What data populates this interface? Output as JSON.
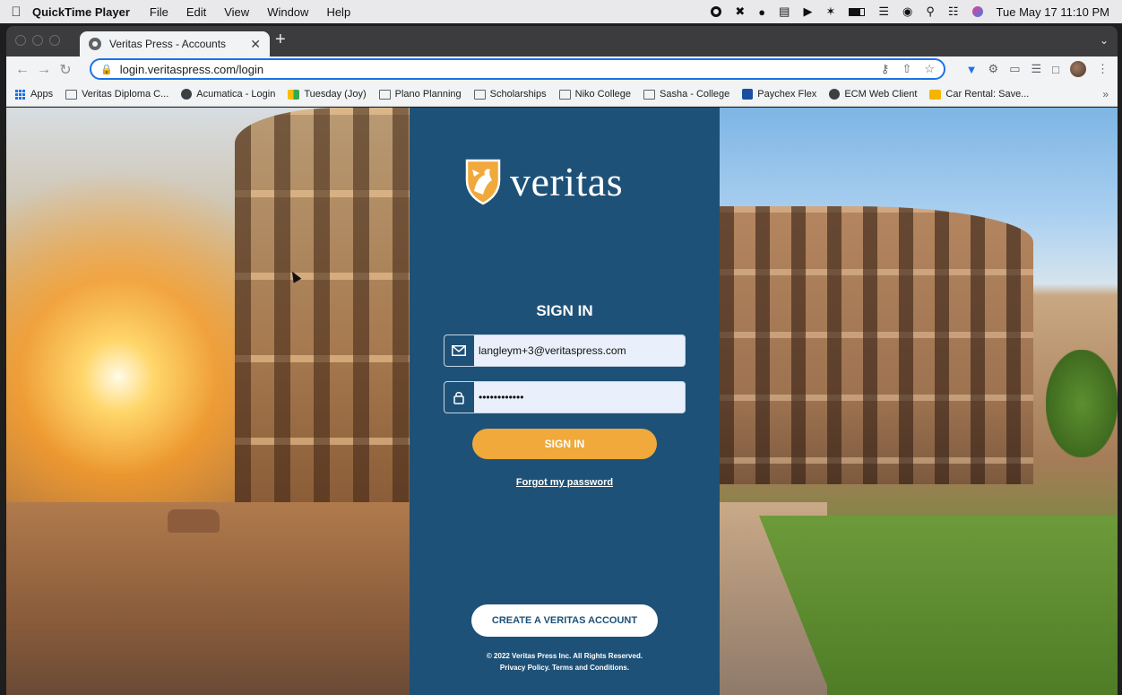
{
  "menubar": {
    "app_name": "QuickTime Player",
    "items": [
      "File",
      "Edit",
      "View",
      "Window",
      "Help"
    ],
    "datetime": "Tue May 17  11:10 PM"
  },
  "browser": {
    "tab_title": "Veritas Press - Accounts",
    "url": "login.veritaspress.com/login",
    "bookmarks": [
      {
        "label": "Apps",
        "icon": "apps-grid-icon"
      },
      {
        "label": "Veritas Diploma C...",
        "icon": "folder-icon"
      },
      {
        "label": "Acumatica - Login",
        "icon": "globe-icon"
      },
      {
        "label": "Tuesday (Joy)",
        "icon": "calendar-icon"
      },
      {
        "label": "Plano Planning",
        "icon": "folder-icon"
      },
      {
        "label": "Scholarships",
        "icon": "folder-icon"
      },
      {
        "label": "Niko College",
        "icon": "folder-icon"
      },
      {
        "label": "Sasha - College",
        "icon": "folder-icon"
      },
      {
        "label": "Paychex Flex",
        "icon": "paychex-icon"
      },
      {
        "label": "ECM Web Client",
        "icon": "globe-icon"
      },
      {
        "label": "Car Rental: Save...",
        "icon": "car-rental-icon"
      }
    ],
    "more": "»"
  },
  "login": {
    "brand": "veritas",
    "title": "SIGN IN",
    "email_value": "langleym+3@veritaspress.com",
    "password_value": "••••••••••••",
    "signin_button": "SIGN IN",
    "forgot": "Forgot my password",
    "create_button": "CREATE A VERITAS ACCOUNT",
    "footer_line1": "© 2022 Veritas Press Inc. All Rights Reserved.",
    "footer_line2": "Privacy Policy. Terms and Conditions."
  },
  "colors": {
    "panel": "#1e5177",
    "accent": "#f0a93a"
  }
}
